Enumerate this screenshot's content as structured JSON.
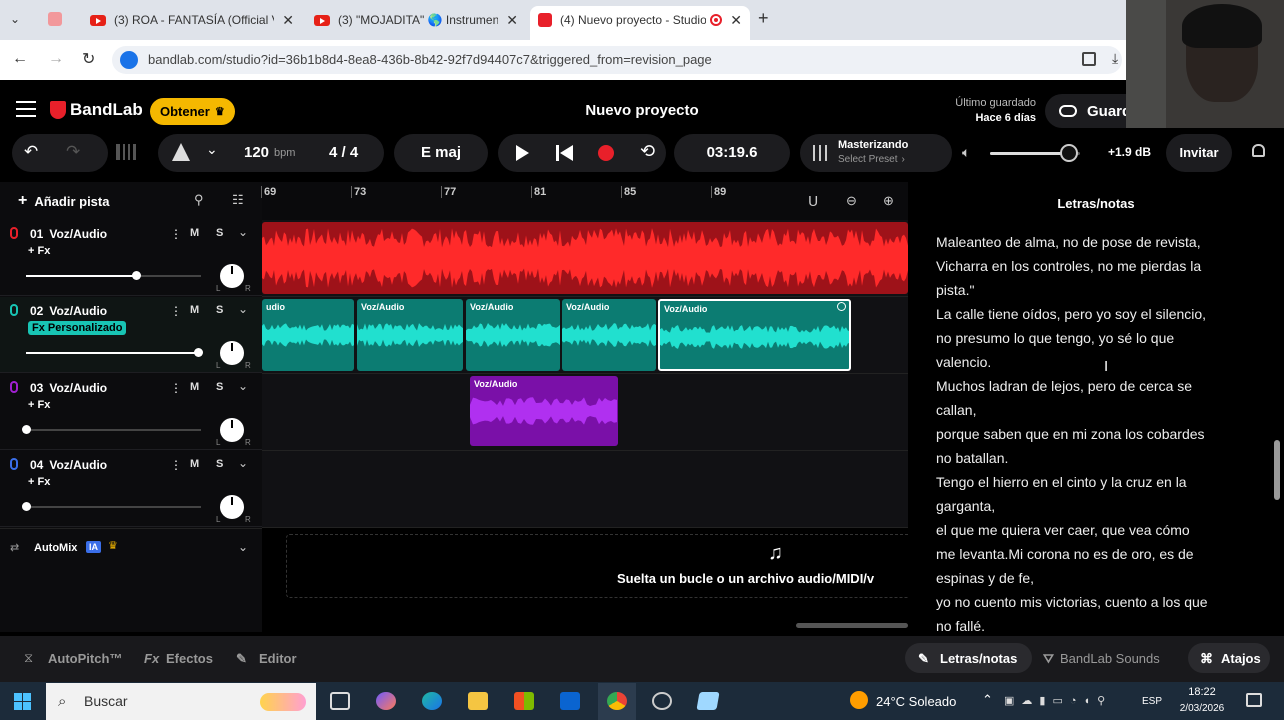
{
  "browser": {
    "tabs": [
      {
        "title": "(3) ROA - FANTASÍA (Official Vi",
        "active": false
      },
      {
        "title": "(3) \"MOJADITA\" 🌎 Instrumenta",
        "active": false
      },
      {
        "title": "(4) Nuevo proyecto - Studio",
        "active": true
      }
    ],
    "url": "bandlab.com/studio?id=36b1b8d4-8ea8-436b-8b42-92f7d94407c7&triggered_from=revision_page"
  },
  "app": {
    "logo": "BandLab",
    "get_button": "Obtener",
    "project_title": "Nuevo proyecto",
    "last_saved_label": "Último guardado",
    "last_saved_value": "Hace 6 días",
    "save_button": "Guard",
    "tempo": "120",
    "tempo_unit": "bpm",
    "time_sig": "4 / 4",
    "key": "E maj",
    "time": "03:19.6",
    "mastering_title": "Masterizando",
    "mastering_preset": "Select Preset",
    "volume_db": "+1.9 dB",
    "volume_level": 0.88,
    "invite": "Invitar"
  },
  "tracks_panel": {
    "add_track": "Añadir pista",
    "automix": "AutoMix",
    "automix_badge": "IA"
  },
  "tracks": [
    {
      "num": "01",
      "name": "Voz/Audio",
      "fx": "+ Fx",
      "volume": 0.63,
      "color": "#e8202a",
      "mute": "M",
      "solo": "S"
    },
    {
      "num": "02",
      "name": "Voz/Audio",
      "fx": "Fx Personalizado",
      "volume": 0.98,
      "color": "#18c4b4",
      "mute": "M",
      "solo": "S"
    },
    {
      "num": "03",
      "name": "Voz/Audio",
      "fx": "+ Fx",
      "volume": 0.0,
      "color": "#a020d0",
      "mute": "M",
      "solo": "S"
    },
    {
      "num": "04",
      "name": "Voz/Audio",
      "fx": "+ Fx",
      "volume": 0.0,
      "color": "#3a6ee8",
      "mute": "M",
      "solo": "S"
    }
  ],
  "ruler": {
    "marks": [
      "69",
      "73",
      "77",
      "81",
      "85",
      "89"
    ]
  },
  "clips": {
    "label": "Voz/Audio",
    "track2_first_label": "udio"
  },
  "dropzone": "Suelta un bucle o un archivo audio/MIDI/v",
  "lyrics": {
    "title": "Letras/notas",
    "lines": [
      "Maleanteo de alma, no de pose de revista,",
      "Vicharra en los controles, no me pierdas la",
      "pista.\"",
      "La calle tiene oídos, pero yo soy el silencio,",
      "no presumo lo que tengo, yo sé lo que",
      "valencio.",
      "Muchos ladran de lejos, pero de cerca se",
      "callan,",
      "porque saben que en mi zona los cobardes",
      "no batallan.",
      "Tengo el hierro en el cinto y la cruz en la",
      "garganta,",
      "el que me quiera ver caer, que vea cómo",
      "me levanta.Mi corona no es de oro, es de",
      "espinas y de fe,",
      "yo no cuento mis victorias, cuento a los que",
      "no fallé."
    ]
  },
  "bottom": {
    "autopitch": "AutoPitch™",
    "effects": "Efectos",
    "editor": "Editor",
    "lyrics_tab": "Letras/notas",
    "sounds": "BandLab Sounds",
    "shortcuts": "Atajos"
  },
  "taskbar": {
    "search": "Buscar",
    "weather": "24°C Soleado",
    "lang": "ESP",
    "time": "18:22",
    "date": "2/03/2026"
  }
}
